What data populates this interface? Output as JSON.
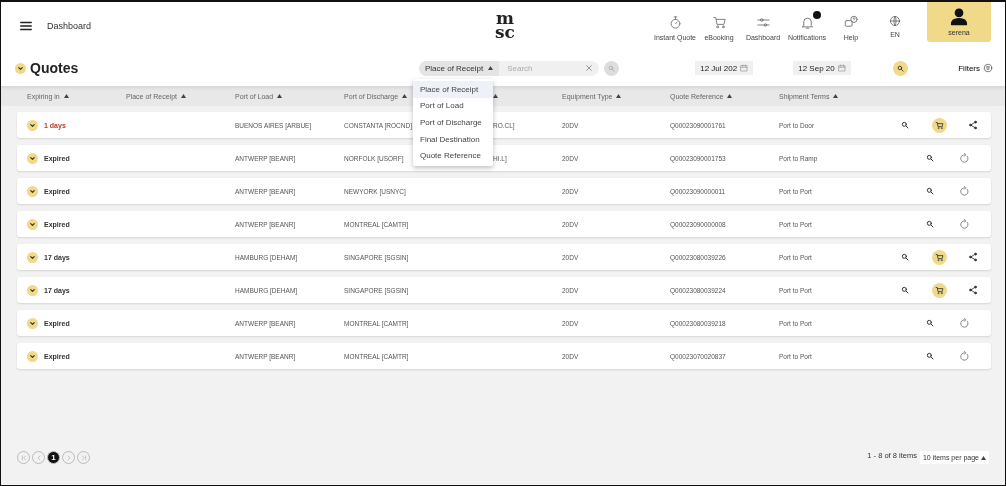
{
  "topbar": {
    "breadcrumb": "Dashboard",
    "logo_top": "m",
    "logo_bottom": "sc",
    "nav": [
      {
        "kind": "stopwatch",
        "label": "Instant Quote"
      },
      {
        "kind": "cart",
        "label": "eBooking"
      },
      {
        "kind": "sliders",
        "label": "Dashboard"
      },
      {
        "kind": "bell",
        "label": "Notifications",
        "badge": true
      },
      {
        "kind": "help",
        "label": "Help"
      },
      {
        "kind": "globe",
        "label": "EN"
      }
    ],
    "user": "serena"
  },
  "toolbar": {
    "title": "Quotes",
    "search_field": "Place of Receipt",
    "search": {
      "placeholder": "Search"
    },
    "date_from": "12 Jul 202",
    "date_to": "12 Sep 20",
    "filters": "Filters"
  },
  "dropdown": [
    {
      "label": "Place of Receipt",
      "selected": true
    },
    {
      "label": "Port of Load",
      "selected": false
    },
    {
      "label": "Port of Discharge",
      "selected": false
    },
    {
      "label": "Final Destination",
      "selected": false
    },
    {
      "label": "Quote Reference",
      "selected": false
    }
  ],
  "table": {
    "columns": [
      "Expiring in",
      "Place of Receipt",
      "Port of Load",
      "Port of Discharge",
      "Equipment Type",
      "Quote Reference",
      "Shipment Terms"
    ],
    "rows": [
      {
        "expiring": "1 days",
        "urgent": true,
        "port_of_load": "BUENOS AIRES [ARBUE]",
        "port_of_discharge": "CONSTANTA [ROCND]",
        "column_5": "RO.CL]",
        "equipment": "20DV",
        "quote_reference": "Q00023090001761",
        "terms": "Port to Door",
        "actions": [
          {
            "kind": "search"
          },
          {
            "kind": "cart"
          },
          {
            "kind": "share"
          }
        ]
      },
      {
        "expiring": "Expired",
        "urgent": false,
        "port_of_load": "ANTWERP [BEANR]",
        "port_of_discharge": "NORFOLK [USORF]",
        "column_5": "HI.L]",
        "equipment": "20DV",
        "quote_reference": "Q00023090001753",
        "terms": "Port to Ramp",
        "actions": [
          {
            "kind": "search"
          },
          {
            "kind": "refresh"
          }
        ]
      },
      {
        "expiring": "Expired",
        "urgent": false,
        "port_of_load": "ANTWERP [BEANR]",
        "port_of_discharge": "NEWYORK [USNYC]",
        "equipment": "20DV",
        "quote_reference": "Q00023090000011",
        "terms": "Port to Port",
        "actions": [
          {
            "kind": "search"
          },
          {
            "kind": "refresh"
          }
        ]
      },
      {
        "expiring": "Expired",
        "urgent": false,
        "port_of_load": "ANTWERP [BEANR]",
        "port_of_discharge": "MONTREAL [CAMTR]",
        "equipment": "20DV",
        "quote_reference": "Q00023090000008",
        "terms": "Port to Port",
        "actions": [
          {
            "kind": "search"
          },
          {
            "kind": "refresh"
          }
        ]
      },
      {
        "expiring": "17 days",
        "urgent": false,
        "port_of_load": "HAMBURG [DEHAM]",
        "port_of_discharge": "SINGAPORE [SGSIN]",
        "equipment": "20DV",
        "quote_reference": "Q00023080039226",
        "terms": "Port to Port",
        "actions": [
          {
            "kind": "search"
          },
          {
            "kind": "cart"
          },
          {
            "kind": "share"
          }
        ]
      },
      {
        "expiring": "17 days",
        "urgent": false,
        "port_of_load": "HAMBURG [DEHAM]",
        "port_of_discharge": "SINGAPORE [SGSIN]",
        "equipment": "20DV",
        "quote_reference": "Q00023080039224",
        "terms": "Port to Port",
        "actions": [
          {
            "kind": "search"
          },
          {
            "kind": "cart"
          },
          {
            "kind": "share"
          }
        ]
      },
      {
        "expiring": "Expired",
        "urgent": false,
        "port_of_load": "ANTWERP [BEANR]",
        "port_of_discharge": "MONTREAL [CAMTR]",
        "equipment": "20DV",
        "quote_reference": "Q00023080039218",
        "terms": "Port to Port",
        "actions": [
          {
            "kind": "search"
          },
          {
            "kind": "refresh"
          }
        ]
      },
      {
        "expiring": "Expired",
        "urgent": false,
        "port_of_load": "ANTWERP [BEANR]",
        "port_of_discharge": "MONTREAL [CAMTR]",
        "equipment": "20DV",
        "quote_reference": "Q00023070020837",
        "terms": "Port to Port",
        "actions": [
          {
            "kind": "search"
          },
          {
            "kind": "refresh"
          }
        ]
      }
    ]
  },
  "pagination": {
    "pages": [
      {
        "label": "1",
        "selected": true
      }
    ],
    "summary": "1 - 8 of 8 items",
    "per_page": "10 items per page"
  }
}
